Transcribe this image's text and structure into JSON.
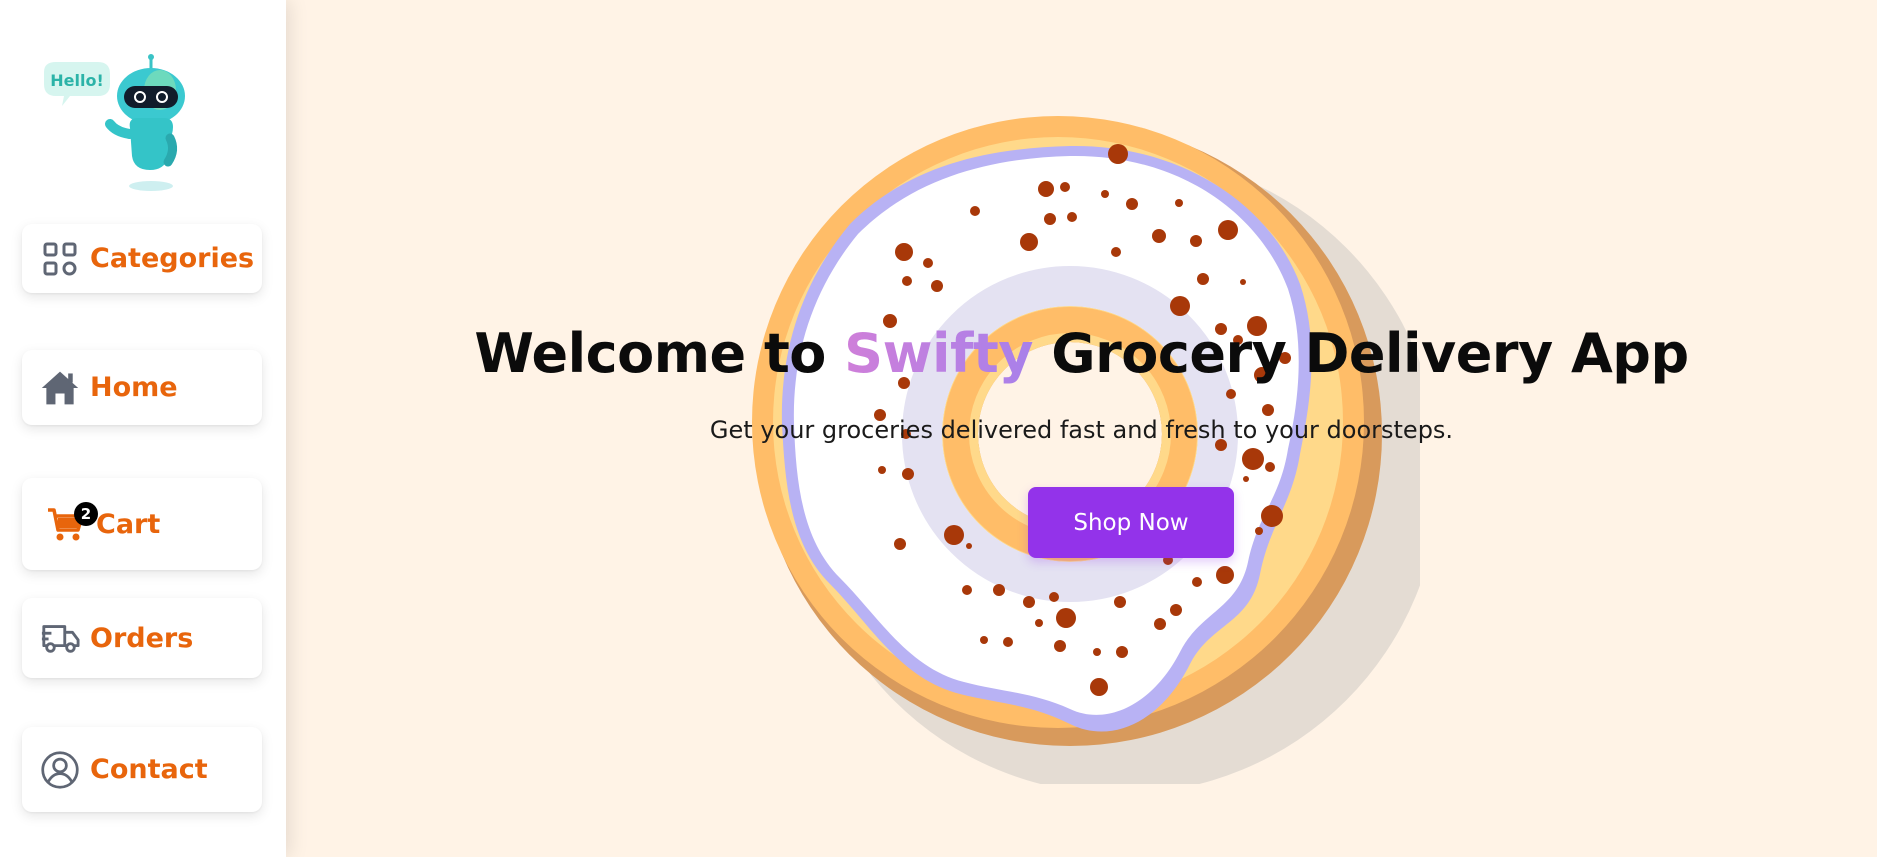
{
  "logo": {
    "bubble_text": "Hello!"
  },
  "sidebar": {
    "items": [
      {
        "label": "Categories",
        "icon": "grid-icon"
      },
      {
        "label": "Home",
        "icon": "home-icon"
      },
      {
        "label": "Cart",
        "icon": "cart-icon",
        "badge": "2"
      },
      {
        "label": "Orders",
        "icon": "truck-icon"
      },
      {
        "label": "Contact",
        "icon": "user-circle-icon"
      }
    ]
  },
  "hero": {
    "title_prefix": "Welcome to ",
    "brand": "Swifty",
    "title_suffix": " Grocery Delivery App",
    "subtitle": "Get your groceries delivered fast and fresh to your doorsteps.",
    "cta": "Shop Now"
  },
  "colors": {
    "accent_orange": "#e8650c",
    "button_purple": "#9333ea",
    "background": "#fff3e6",
    "icon_gray": "#5f6674"
  }
}
